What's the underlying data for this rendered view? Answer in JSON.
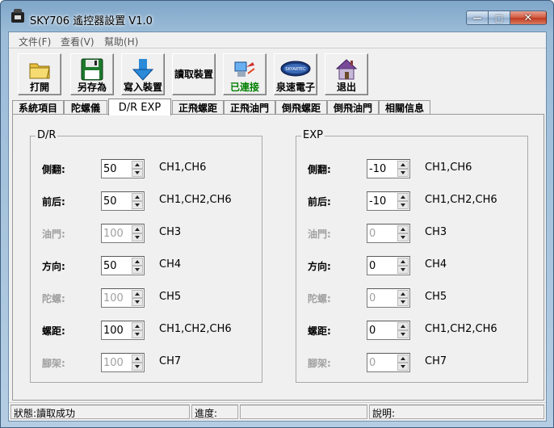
{
  "window": {
    "title": "SKY706 遙控器設置 V1.0"
  },
  "caption": {
    "minimize": "—",
    "maximize": "□",
    "close": "✕"
  },
  "menu": [
    "文件(F)",
    "查看(V)",
    "幫助(H)"
  ],
  "toolbar": {
    "open": "打開",
    "save_as": "另存為",
    "write": "寫入裝置",
    "read": "讀取裝置",
    "connected": "已連接",
    "brand": "泉速電子",
    "exit": "退出",
    "connected_color": "#008000",
    "brand_logo_text": "SKYARTEC"
  },
  "tabs": [
    "系統項目",
    "陀螺儀",
    "D/R EXP",
    "正飛螺距",
    "正飛油門",
    "倒飛螺距",
    "倒飛油門",
    "相關信息"
  ],
  "active_tab": "D/R EXP",
  "dr": {
    "title": "D/R",
    "rows": [
      {
        "label": "側翻:",
        "value": "50",
        "ch": "CH1,CH6",
        "enabled": true
      },
      {
        "label": "前后:",
        "value": "50",
        "ch": "CH1,CH2,CH6",
        "enabled": true
      },
      {
        "label": "油門:",
        "value": "100",
        "ch": "CH3",
        "enabled": false
      },
      {
        "label": "方向:",
        "value": "50",
        "ch": "CH4",
        "enabled": true
      },
      {
        "label": "陀螺:",
        "value": "100",
        "ch": "CH5",
        "enabled": false
      },
      {
        "label": "螺距:",
        "value": "100",
        "ch": "CH1,CH2,CH6",
        "enabled": true
      },
      {
        "label": "腳架:",
        "value": "100",
        "ch": "CH7",
        "enabled": false
      }
    ]
  },
  "exp": {
    "title": "EXP",
    "rows": [
      {
        "label": "側翻:",
        "value": "-10",
        "ch": "CH1,CH6",
        "enabled": true
      },
      {
        "label": "前后:",
        "value": "-10",
        "ch": "CH1,CH2,CH6",
        "enabled": true
      },
      {
        "label": "油門:",
        "value": "0",
        "ch": "CH3",
        "enabled": false
      },
      {
        "label": "方向:",
        "value": "0",
        "ch": "CH4",
        "enabled": true
      },
      {
        "label": "陀螺:",
        "value": "0",
        "ch": "CH5",
        "enabled": false
      },
      {
        "label": "螺距:",
        "value": "0",
        "ch": "CH1,CH2,CH6",
        "enabled": true
      },
      {
        "label": "腳架:",
        "value": "0",
        "ch": "CH7",
        "enabled": false
      }
    ]
  },
  "status": {
    "state": "狀態:讀取成功",
    "progress": "進度:",
    "note": "說明:"
  }
}
